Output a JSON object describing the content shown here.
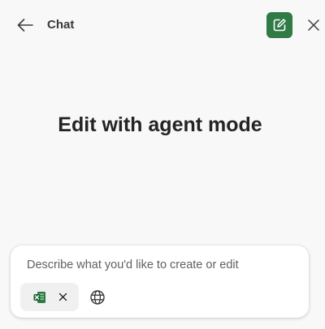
{
  "header": {
    "title": "Chat",
    "back_icon": "back-arrow-icon",
    "new_chat_icon": "compose-icon",
    "close_icon": "close-icon",
    "accent_color": "#2f7a45"
  },
  "main": {
    "headline": "Edit with agent mode"
  },
  "composer": {
    "placeholder": "Describe what you'd like to create or edit",
    "value": "",
    "attachment": {
      "icon": "excel-file-icon",
      "remove_icon": "close-icon"
    },
    "web_icon": "globe-icon"
  }
}
